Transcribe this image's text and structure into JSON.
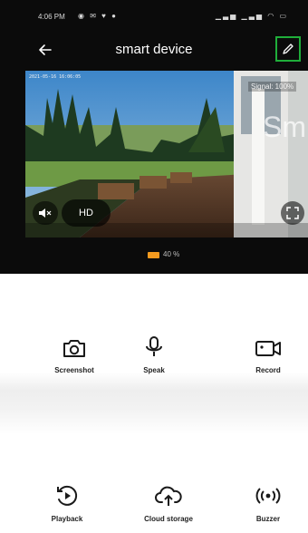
{
  "status_bar": {
    "time": "4:06 PM",
    "left_icons": "◉ ✉ ♥ ●",
    "right_icons": "▁▃▅ ▁▃▅ ◠ ▭"
  },
  "header": {
    "title": "smart device",
    "back_icon": "arrow-left-icon",
    "edit_icon": "pencil-icon"
  },
  "video": {
    "timestamp": "2021-05-16 16:06:05",
    "signal": "Signal: 100%",
    "watermark": "Sm",
    "quality_label": "HD",
    "mute_icon": "speaker-mute-icon",
    "fullscreen_icon": "fullscreen-icon"
  },
  "bitrate": {
    "text": "40 %",
    "indicator_color": "#f39a1f"
  },
  "actions": [
    {
      "label": "Screenshot",
      "icon": "camera-icon"
    },
    {
      "label": "Speak",
      "icon": "microphone-icon"
    },
    {
      "label": "Record",
      "icon": "video-camera-icon"
    },
    {
      "label": "Playback",
      "icon": "playback-icon"
    },
    {
      "label": "Cloud storage",
      "icon": "cloud-icon"
    },
    {
      "label": "Buzzer",
      "icon": "buzzer-icon"
    }
  ],
  "colors": {
    "accent_green": "#1fae3a",
    "header_bg": "#0b0b0b"
  }
}
